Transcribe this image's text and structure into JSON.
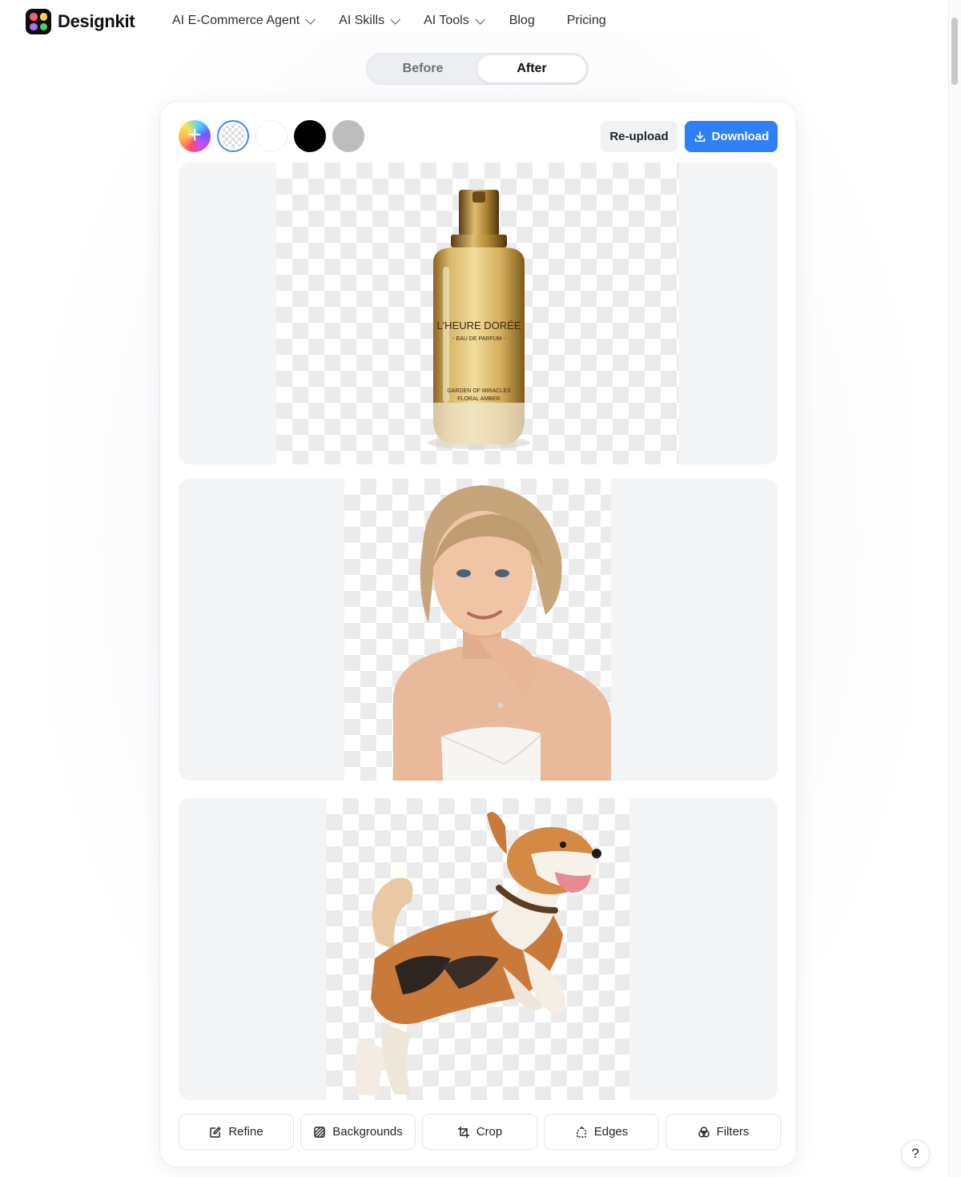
{
  "brand": {
    "name": "Designkit"
  },
  "nav": {
    "items": [
      {
        "label": "AI E-Commerce Agent",
        "has_dropdown": true
      },
      {
        "label": "AI Skills",
        "has_dropdown": true
      },
      {
        "label": "AI Tools",
        "has_dropdown": true
      },
      {
        "label": "Blog",
        "has_dropdown": false
      },
      {
        "label": "Pricing",
        "has_dropdown": false
      }
    ]
  },
  "view_toggle": {
    "before_label": "Before",
    "after_label": "After",
    "selected": "After"
  },
  "editor": {
    "background_swatches": [
      {
        "name": "add-color",
        "icon": "plus-icon"
      },
      {
        "name": "transparent",
        "selected": true
      },
      {
        "name": "white",
        "color": "#ffffff"
      },
      {
        "name": "black",
        "color": "#000000"
      },
      {
        "name": "gray",
        "color": "#bdbdbd"
      }
    ],
    "reupload_label": "Re-upload",
    "download_label": "Download",
    "download_icon": "download-icon",
    "accent_color": "#2f80f7"
  },
  "images": [
    {
      "subject": "perfume bottle",
      "label_title": "L'HEURE DORÉE",
      "label_subtitle": "- EAU DE PARFUM -",
      "label_line1": "GARDEN OF MIRACLES",
      "label_line2": "FLORAL AMBER"
    },
    {
      "subject": "woman portrait"
    },
    {
      "subject": "jumping corgi dog"
    }
  ],
  "tools": [
    {
      "label": "Refine",
      "icon": "edit-icon"
    },
    {
      "label": "Backgrounds",
      "icon": "pattern-icon"
    },
    {
      "label": "Crop",
      "icon": "crop-icon"
    },
    {
      "label": "Edges",
      "icon": "edges-icon"
    },
    {
      "label": "Filters",
      "icon": "filters-icon"
    }
  ],
  "help": {
    "label": "?"
  }
}
